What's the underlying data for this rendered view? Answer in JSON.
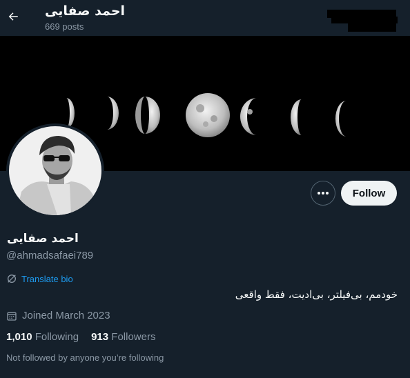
{
  "header": {
    "name": "احمد صفایی",
    "posts": "669 posts"
  },
  "profile": {
    "name": "احمد صفایی",
    "handle": "@ahmadsafaei789",
    "translate_label": "Translate bio",
    "bio": "خودمم، بی‌فیلتر، بی‌ادیت، فقط واقعی",
    "joined": "Joined March 2023",
    "following_count": "1,010",
    "following_label": "Following",
    "followers_count": "913",
    "followers_label": "Followers",
    "not_followed": "Not followed by anyone you’re following"
  },
  "actions": {
    "follow_label": "Follow"
  },
  "icons": {
    "back": "arrow-left-icon",
    "more": "more-dots-icon",
    "translate": "globe-slash-icon",
    "calendar": "calendar-icon"
  },
  "colors": {
    "background": "#15202b",
    "accent": "#1d9bf0",
    "muted": "#8b98a5",
    "follow_bg": "#eff3f4"
  }
}
